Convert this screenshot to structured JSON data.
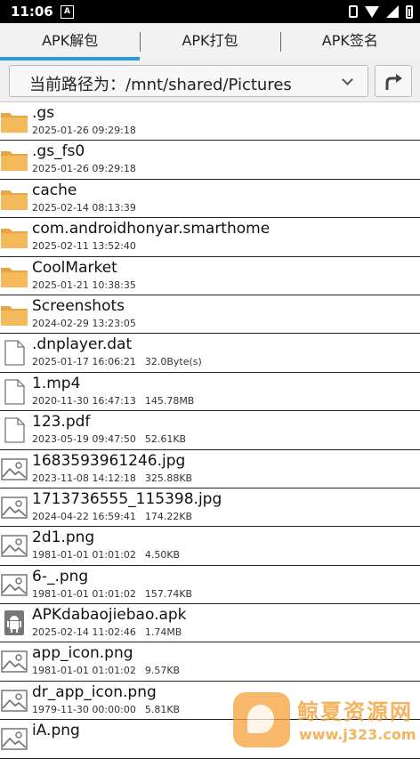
{
  "status_bar": {
    "time": "11:06",
    "notif_badge": "A"
  },
  "tabs": [
    {
      "label": "APK解包",
      "active": true
    },
    {
      "label": "APK打包",
      "active": false
    },
    {
      "label": "APK签名",
      "active": false
    }
  ],
  "path_bar": {
    "text": "当前路径为：/mnt/shared/Pictures"
  },
  "files": [
    {
      "name": ".gs",
      "date": "2025-01-26 09:29:18",
      "size": "",
      "icon": "folder-icon"
    },
    {
      "name": ".gs_fs0",
      "date": "2025-01-26 09:29:18",
      "size": "",
      "icon": "folder-icon"
    },
    {
      "name": "cache",
      "date": "2025-02-14 08:13:39",
      "size": "",
      "icon": "folder-icon"
    },
    {
      "name": "com.androidhonyar.smarthome",
      "date": "2025-02-11 13:52:40",
      "size": "",
      "icon": "folder-icon"
    },
    {
      "name": "CoolMarket",
      "date": "2025-01-21 10:38:35",
      "size": "",
      "icon": "folder-icon"
    },
    {
      "name": "Screenshots",
      "date": "2024-02-29 13:23:05",
      "size": "",
      "icon": "folder-icon"
    },
    {
      "name": ".dnplayer.dat",
      "date": "2025-01-17 16:06:21",
      "size": "32.0Byte(s)",
      "icon": "file-icon"
    },
    {
      "name": "1.mp4",
      "date": "2020-11-30 16:47:13",
      "size": "145.78MB",
      "icon": "file-icon"
    },
    {
      "name": "123.pdf",
      "date": "2023-05-19 09:47:50",
      "size": "52.61KB",
      "icon": "file-icon"
    },
    {
      "name": "1683593961246.jpg",
      "date": "2023-11-08 14:12:18",
      "size": "325.88KB",
      "icon": "image-icon"
    },
    {
      "name": "1713736555_115398.jpg",
      "date": "2024-04-22 16:59:41",
      "size": "174.22KB",
      "icon": "image-icon"
    },
    {
      "name": "2d1.png",
      "date": "1981-01-01 01:01:02",
      "size": "4.50KB",
      "icon": "image-icon"
    },
    {
      "name": "6-_.png",
      "date": "1981-01-01 01:01:02",
      "size": "157.74KB",
      "icon": "image-icon"
    },
    {
      "name": "APKdabaojiebao.apk",
      "date": "2025-02-14 11:02:46",
      "size": "1.74MB",
      "icon": "android-icon"
    },
    {
      "name": "app_icon.png",
      "date": "1981-01-01 01:01:02",
      "size": "9.57KB",
      "icon": "image-icon"
    },
    {
      "name": "dr_app_icon.png",
      "date": "1979-11-30 00:00:00",
      "size": "5.81KB",
      "icon": "image-icon"
    },
    {
      "name": "iA.png",
      "date": "",
      "size": "",
      "icon": "image-icon"
    }
  ],
  "watermark": {
    "title": "鲸夏资源网",
    "url": "www.j323.com"
  },
  "colors": {
    "tab_indicator": "#2b9bd8",
    "folder": "#e8a544",
    "watermark": "#f09a2a"
  }
}
